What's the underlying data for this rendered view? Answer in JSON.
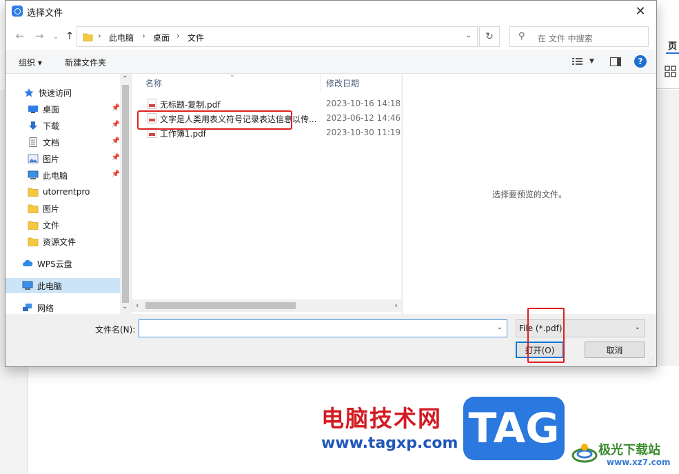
{
  "dialog": {
    "title": "选择文件",
    "close_glyph": "✕"
  },
  "nav": {
    "back_glyph": "←",
    "forward_glyph": "→",
    "recent_glyph": "⌄",
    "up_glyph": "↑",
    "breadcrumb": [
      "此电脑",
      "桌面",
      "文件"
    ],
    "refresh_glyph": "↻",
    "search_placeholder": "在 文件 中搜索"
  },
  "toolbar": {
    "organize_label": "组织 ▾",
    "new_folder_label": "新建文件夹",
    "help_glyph": "?"
  },
  "sidebar": {
    "items": [
      {
        "label": "快速访问",
        "icon": "star-icon",
        "pinned": false
      },
      {
        "label": "桌面",
        "icon": "desktop-icon",
        "pinned": true
      },
      {
        "label": "下载",
        "icon": "download-icon",
        "pinned": true
      },
      {
        "label": "文档",
        "icon": "document-icon",
        "pinned": true
      },
      {
        "label": "图片",
        "icon": "picture-icon",
        "pinned": true
      },
      {
        "label": "此电脑",
        "icon": "computer-icon",
        "pinned": true
      },
      {
        "label": "utorrentpro",
        "icon": "folder-icon",
        "pinned": false
      },
      {
        "label": "图片",
        "icon": "folder-icon",
        "pinned": false
      },
      {
        "label": "文件",
        "icon": "folder-icon",
        "pinned": false
      },
      {
        "label": "资源文件",
        "icon": "folder-icon",
        "pinned": false
      },
      {
        "label": "WPS云盘",
        "icon": "cloud-icon",
        "pinned": false
      },
      {
        "label": "此电脑",
        "icon": "computer-icon",
        "pinned": false,
        "selected": true
      },
      {
        "label": "网络",
        "icon": "network-icon",
        "pinned": false
      }
    ]
  },
  "filelist": {
    "col_name": "名称",
    "col_date": "修改日期",
    "rows": [
      {
        "name": "无标题-复制.pdf",
        "date": "2023-10-16 14:18"
      },
      {
        "name": "文字是人类用表义符号记录表达信息以传...",
        "date": "2023-06-12 14:46"
      },
      {
        "name": "工作簿1.pdf",
        "date": "2023-10-30 11:19"
      }
    ]
  },
  "preview": {
    "message": "选择要预览的文件。"
  },
  "bottom": {
    "filename_label": "文件名(N):",
    "filename_value": "",
    "filter_value": "File (*.pdf)",
    "open_label": "打开(O)",
    "cancel_label": "取消"
  },
  "background_app": {
    "tab_label": "页"
  },
  "watermark": {
    "cn_text": "电脑技术网",
    "url_text": "www.tagxp.com",
    "tag_text": "TAG",
    "brand_text": "极光下载站",
    "brand_url": "www.xz7.com"
  },
  "colors": {
    "accent": "#0078d7",
    "highlight_box": "#e02020",
    "selection": "#cce4f7"
  }
}
